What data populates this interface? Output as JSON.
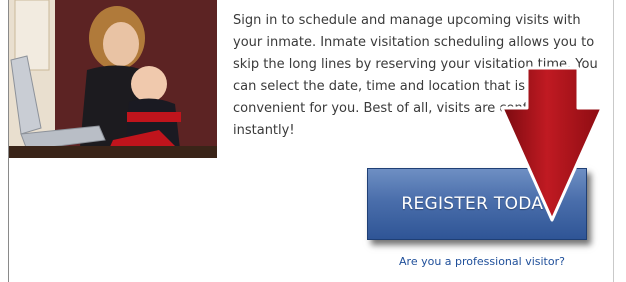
{
  "intro": {
    "text": "Sign in to schedule and manage upcoming visits with your inmate. Inmate visitation scheduling allows you to skip the long lines by reserving your visitation time. You can select the date, time and location that is most convenient for you. Best of all, visits are confirmed instantly!"
  },
  "register": {
    "label": "REGISTER TODAY"
  },
  "professional_link": {
    "label": "Are you a professional visitor?"
  },
  "colors": {
    "button": "#4a6eab",
    "arrow": "#b3121b",
    "link": "#1f4f9a"
  },
  "icons": {
    "arrow": "down-arrow-icon"
  }
}
